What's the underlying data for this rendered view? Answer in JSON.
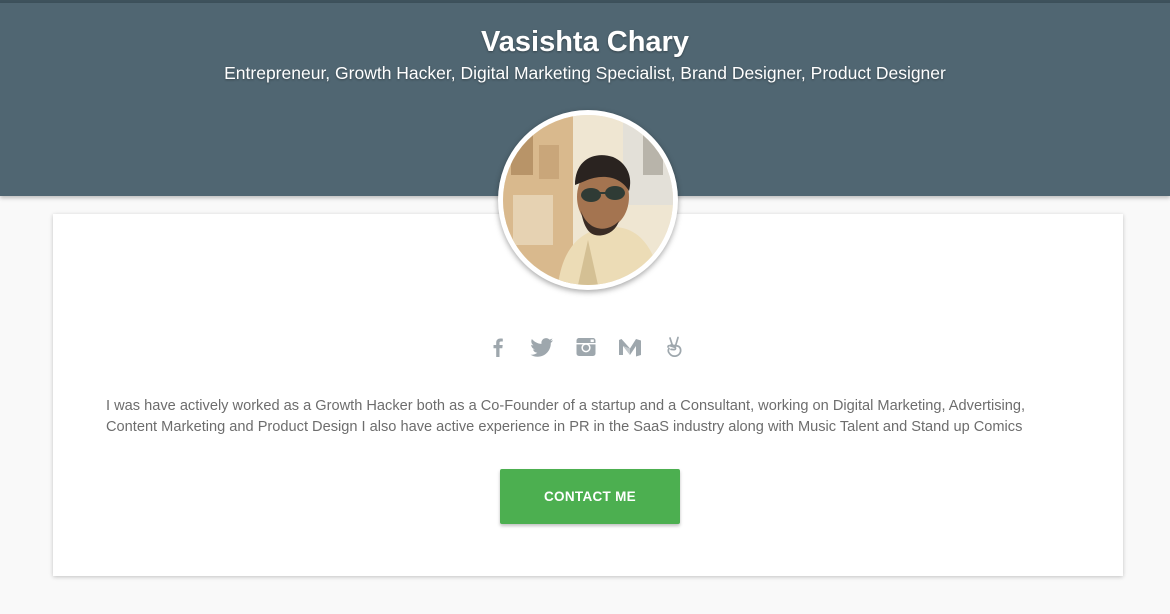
{
  "profile": {
    "name": "Vasishta Chary",
    "subtitle": "Entrepreneur, Growth Hacker, Digital Marketing Specialist, Brand Designer, Product Designer",
    "bio": "I was have actively worked as a Growth Hacker both as a Co-Founder of a startup and a Consultant, working on Digital Marketing, Advertising, Content Marketing and Product Design I also have active experience in PR in the SaaS industry along with Music Talent and Stand up Comics"
  },
  "social_links": [
    {
      "icon": "facebook-icon"
    },
    {
      "icon": "twitter-icon"
    },
    {
      "icon": "instagram-icon"
    },
    {
      "icon": "medium-icon"
    },
    {
      "icon": "angellist-icon"
    }
  ],
  "contact_button": {
    "label": "CONTACT ME"
  },
  "colors": {
    "header_bg": "#506672",
    "page_bg": "#f9f9f9",
    "card_bg": "#ffffff",
    "button_bg": "#4caf50",
    "icon_color": "#9ea7ad",
    "text_color": "#6d6d6d"
  }
}
